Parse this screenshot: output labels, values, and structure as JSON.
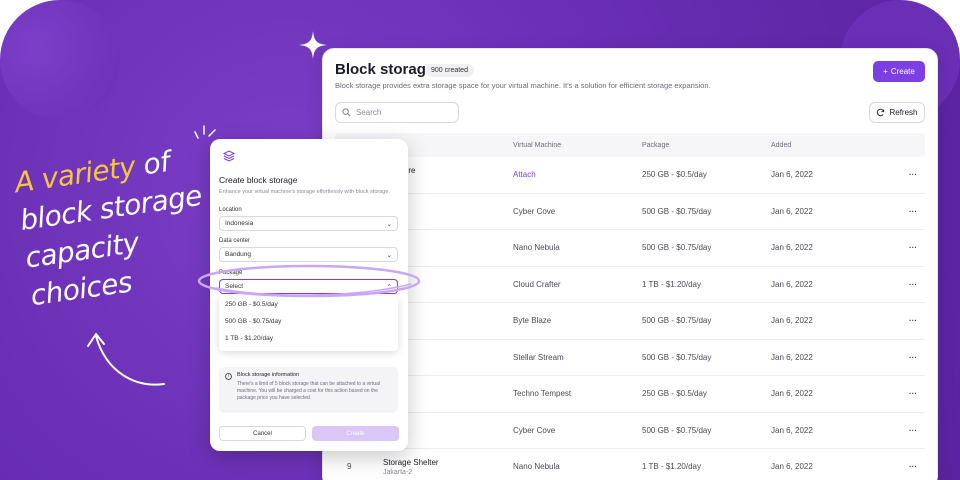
{
  "headline": {
    "accent": "A variety",
    "rest_line1": "of",
    "line2": "block storage",
    "line3": "capacity",
    "line4": "choices"
  },
  "colors": {
    "brand": "#7b3fe4",
    "background": "#6a2fb5",
    "accent_text": "#f5c542"
  },
  "page": {
    "title": "Block storage",
    "count_badge": "900 created",
    "subtitle": "Block storage provides extra storage space for your virtual machine. It's a solution for efficient storage expansion.",
    "create_label": "Create",
    "search_placeholder": "Search",
    "refresh_label": "Refresh"
  },
  "table": {
    "headers": [
      "",
      "",
      "Virtual Machine",
      "Package",
      "Added",
      ""
    ],
    "rows": [
      {
        "num": "",
        "name": "e Sphere",
        "sub": "-1",
        "vm": "Attach",
        "vm_link": true,
        "package": "250 GB - $0.5/day",
        "added": "Jan 6, 2022"
      },
      {
        "num": "",
        "name": "unker",
        "sub": "-1",
        "vm": "Cyber Cove",
        "package": "500 GB - $0.75/day",
        "added": "Jan 6, 2022"
      },
      {
        "num": "",
        "name": "ult",
        "sub": "-2",
        "vm": "Nano Nebula",
        "package": "500 GB - $0.75/day",
        "added": "Jan 6, 2022"
      },
      {
        "num": "",
        "name": "",
        "sub": "",
        "vm": "Cloud Crafter",
        "package": "1 TB - $1.20/day",
        "added": "Jan 6, 2022"
      },
      {
        "num": "",
        "name": "aven",
        "sub": "ore-1",
        "vm": "Byte Blaze",
        "package": "500 GB - $0.75/day",
        "added": "Jan 6, 2022"
      },
      {
        "num": "",
        "name": "ock",
        "sub": "-2",
        "vm": "Stellar Stream",
        "package": "500 GB - $0.75/day",
        "added": "Jan 6, 2022"
      },
      {
        "num": "",
        "name": "epot",
        "sub": "ore-2",
        "vm": "Techno Tempest",
        "package": "250 GB - $0.5/day",
        "added": "Jan 6, 2022"
      },
      {
        "num": "",
        "name": "nctum",
        "sub": "-1",
        "vm": "Cyber Cove",
        "package": "500 GB - $0.75/day",
        "added": "Jan 6, 2022"
      },
      {
        "num": "9",
        "name": "Storage Shelter",
        "sub": "Jakarta-2",
        "vm": "Nano Nebula",
        "package": "1 TB - $1.20/day",
        "added": "Jan 6, 2022"
      }
    ],
    "row_action": "···"
  },
  "modal": {
    "title": "Create block storage",
    "subtitle": "Enhance your virtual machine's storage effortlessly with block storage.",
    "location_label": "Location",
    "location_value": "Indonesia",
    "datacenter_label": "Data center",
    "datacenter_value": "Bandung",
    "package_label": "Package",
    "package_value": "Select",
    "package_options": [
      "250 GB - $0.5/day",
      "500 GB - $0.75/day",
      "1 TB - $1.20/day"
    ],
    "hidden_select": "Select",
    "info_title": "Block storage information",
    "info_text": "There's a limit of 5 block storage that can be attached to a virtual machine. You will be charged a cost for this action based on the package price you have selected.",
    "cancel_label": "Cancel",
    "create_label": "Create"
  }
}
